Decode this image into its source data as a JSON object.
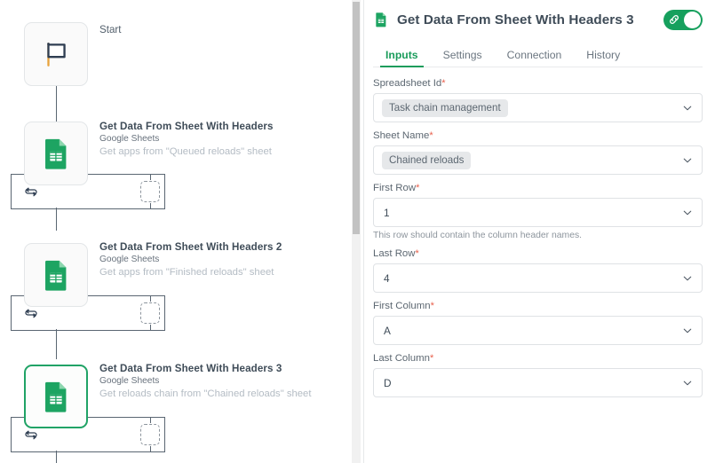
{
  "flow": {
    "start": {
      "label": "Start",
      "icon": "flag-icon"
    },
    "nodes": [
      {
        "title": "Get Data From Sheet With Headers",
        "app": "Google Sheets",
        "description": "Get apps from \"Queued reloads\" sheet",
        "icon": "google-sheets-icon",
        "selected": false
      },
      {
        "title": "Get Data From Sheet With Headers 2",
        "app": "Google Sheets",
        "description": "Get apps from \"Finished reloads\" sheet",
        "icon": "google-sheets-icon",
        "selected": false
      },
      {
        "title": "Get Data From Sheet With Headers 3",
        "app": "Google Sheets",
        "description": "Get reloads chain from \"Chained reloads\" sheet",
        "icon": "google-sheets-icon",
        "selected": true
      }
    ],
    "loop_icon": "loop-icon",
    "placeholder_icon": "add-step-placeholder"
  },
  "panel": {
    "icon": "google-sheets-icon",
    "title": "Get Data From Sheet With Headers 3",
    "enabled_toggle": {
      "name": "connection-toggle",
      "state": "on",
      "icon": "link-icon"
    },
    "tabs": [
      {
        "label": "Inputs",
        "active": true
      },
      {
        "label": "Settings",
        "active": false
      },
      {
        "label": "Connection",
        "active": false
      },
      {
        "label": "History",
        "active": false
      }
    ],
    "fields": [
      {
        "label": "Spreadsheet Id",
        "required": true,
        "value": "Task chain management",
        "style": "chip",
        "hint": ""
      },
      {
        "label": "Sheet Name",
        "required": true,
        "value": "Chained reloads",
        "style": "chip",
        "hint": ""
      },
      {
        "label": "First Row",
        "required": true,
        "value": "1",
        "style": "plain",
        "hint": "This row should contain the column header names."
      },
      {
        "label": "Last Row",
        "required": true,
        "value": "4",
        "style": "plain",
        "hint": ""
      },
      {
        "label": "First Column",
        "required": true,
        "value": "A",
        "style": "plain",
        "hint": ""
      },
      {
        "label": "Last Column",
        "required": true,
        "value": "D",
        "style": "plain",
        "hint": ""
      }
    ],
    "required_marker": "*"
  },
  "colors": {
    "accent_green": "#16a05d",
    "toggle_on": "#16a05d",
    "selected_border": "#20a366",
    "required_red": "#e8604c",
    "sheets_green": "#1da462"
  }
}
